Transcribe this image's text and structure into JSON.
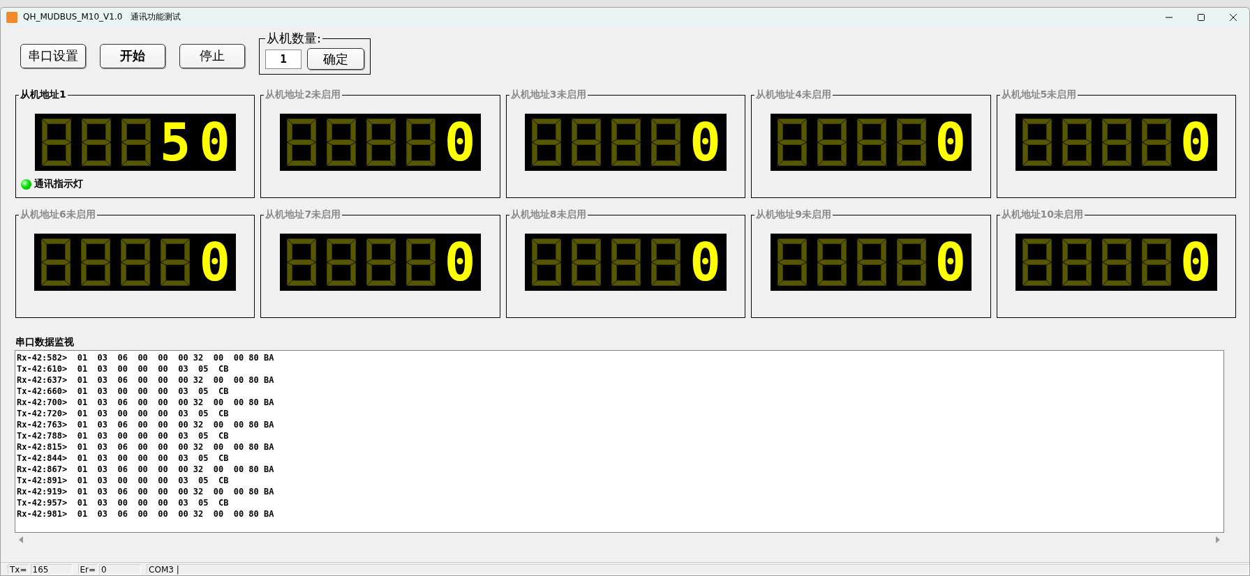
{
  "window": {
    "title": "QH_MUDBUS_M10_V1.0   通讯功能测试"
  },
  "toolbar": {
    "buttons": [
      {
        "label": "串口设置",
        "bold": false
      },
      {
        "label": "开始",
        "bold": true
      },
      {
        "label": "停止",
        "bold": false
      }
    ],
    "slave_count": {
      "label": "从机数量:",
      "value": "1",
      "button": "确定"
    }
  },
  "panels": [
    {
      "title": "从机地址1",
      "enabled": true,
      "value": "50",
      "indicator": {
        "label": "通讯指示灯",
        "on": true
      }
    },
    {
      "title": "从机地址2未启用",
      "enabled": false,
      "value": "0"
    },
    {
      "title": "从机地址3未启用",
      "enabled": false,
      "value": "0"
    },
    {
      "title": "从机地址4未启用",
      "enabled": false,
      "value": "0"
    },
    {
      "title": "从机地址5未启用",
      "enabled": false,
      "value": "0"
    },
    {
      "title": "从机地址6未启用",
      "enabled": false,
      "value": "0"
    },
    {
      "title": "从机地址7未启用",
      "enabled": false,
      "value": "0"
    },
    {
      "title": "从机地址8未启用",
      "enabled": false,
      "value": "0"
    },
    {
      "title": "从机地址9未启用",
      "enabled": false,
      "value": "0"
    },
    {
      "title": "从机地址10未启用",
      "enabled": false,
      "value": "0"
    }
  ],
  "monitor": {
    "label": "串口数据监视",
    "lines": [
      "Rx-42:582>  01  03  06  00  00  00 32  00  00 80 BA",
      "Tx-42:610>  01  03  00  00  00  03  05  CB",
      "Rx-42:637>  01  03  06  00  00  00 32  00  00 80 BA",
      "Tx-42:660>  01  03  00  00  00  03  05  CB",
      "Rx-42:700>  01  03  06  00  00  00 32  00  00 80 BA",
      "Tx-42:720>  01  03  00  00  00  03  05  CB",
      "Rx-42:763>  01  03  06  00  00  00 32  00  00 80 BA",
      "Tx-42:788>  01  03  00  00  00  03  05  CB",
      "Rx-42:815>  01  03  06  00  00  00 32  00  00 80 BA",
      "Tx-42:844>  01  03  00  00  00  03  05  CB",
      "Rx-42:867>  01  03  06  00  00  00 32  00  00 80 BA",
      "Tx-42:891>  01  03  00  00  00  03  05  CB",
      "Rx-42:919>  01  03  06  00  00  00 32  00  00 80 BA",
      "Tx-42:957>  01  03  00  00  00  03  05  CB",
      "Rx-42:981>  01  03  06  00  00  00 32  00  00 80 BA"
    ]
  },
  "status_bar": [
    {
      "label": "Tx=",
      "value": "165"
    },
    {
      "label": "Er=",
      "value": "0"
    },
    {
      "value": "COM3 |"
    }
  ]
}
